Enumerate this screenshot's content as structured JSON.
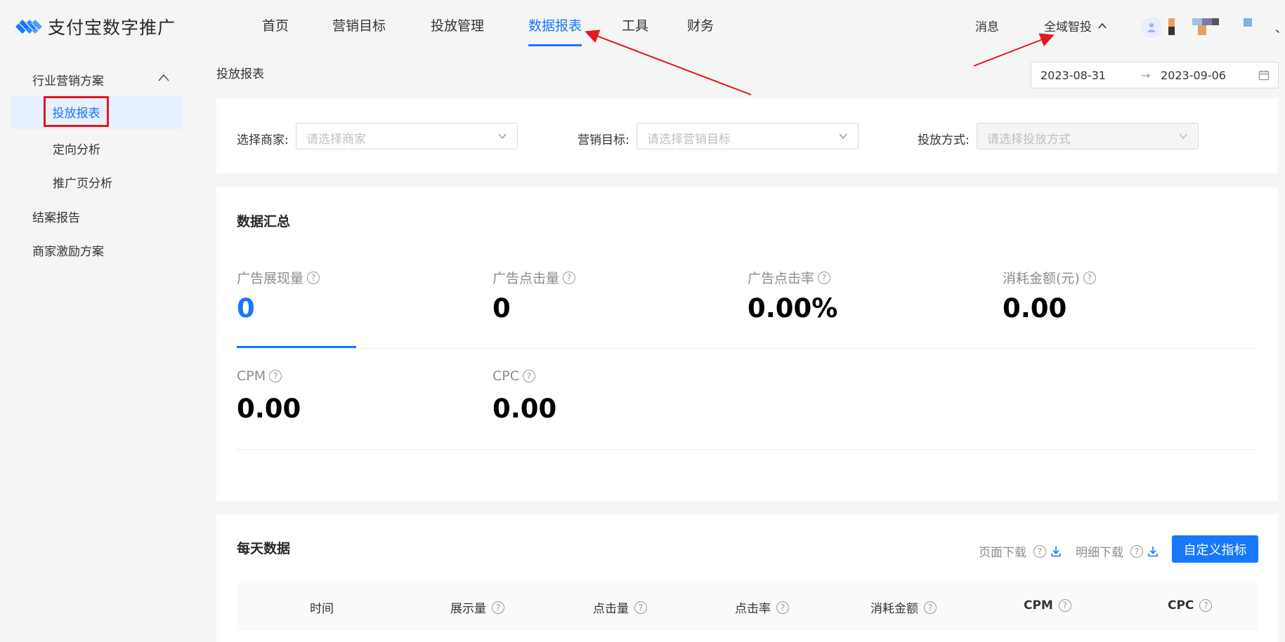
{
  "header": {
    "brand": "支付宝数字推广",
    "nav": [
      {
        "label": "首页",
        "active": false
      },
      {
        "label": "营销目标",
        "active": false
      },
      {
        "label": "投放管理",
        "active": false
      },
      {
        "label": "数据报表",
        "active": true
      },
      {
        "label": "工具",
        "active": false
      },
      {
        "label": "财务",
        "active": false
      }
    ],
    "messages": "消息",
    "mode": "全域智投",
    "trailing_mark": "、"
  },
  "sidebar": {
    "group": "行业营销方案",
    "sub_items": [
      "投放报表",
      "定向分析",
      "推广页分析"
    ],
    "items": [
      "结案报告",
      "商家激励方案"
    ]
  },
  "breadcrumb": "投放报表",
  "date_range": {
    "start": "2023-08-31",
    "separator": "→",
    "end": "2023-09-06"
  },
  "filters": [
    {
      "label": "选择商家:",
      "placeholder": "请选择商家",
      "disabled": false
    },
    {
      "label": "营销目标:",
      "placeholder": "请选择营销目标",
      "disabled": false
    },
    {
      "label": "投放方式:",
      "placeholder": "请选择投放方式",
      "disabled": true
    }
  ],
  "summary": {
    "title": "数据汇总",
    "metrics": [
      {
        "label": "广告展现量",
        "value": "0"
      },
      {
        "label": "广告点击量",
        "value": "0"
      },
      {
        "label": "广告点击率",
        "value": "0.00%"
      },
      {
        "label": "消耗金额(元)",
        "value": "0.00"
      },
      {
        "label": "CPM",
        "value": "0.00"
      },
      {
        "label": "CPC",
        "value": "0.00"
      }
    ]
  },
  "daily": {
    "title": "每天数据",
    "page_download": "页面下载",
    "detail_download": "明细下载",
    "custom_button": "自定义指标",
    "columns": [
      "时间",
      "展示量",
      "点击量",
      "点击率",
      "消耗金额",
      "CPM",
      "CPC"
    ]
  },
  "colors": {
    "primary": "#1677ff",
    "highlight_box": "#e4161f",
    "annotation_arrow": "#e4161f"
  }
}
